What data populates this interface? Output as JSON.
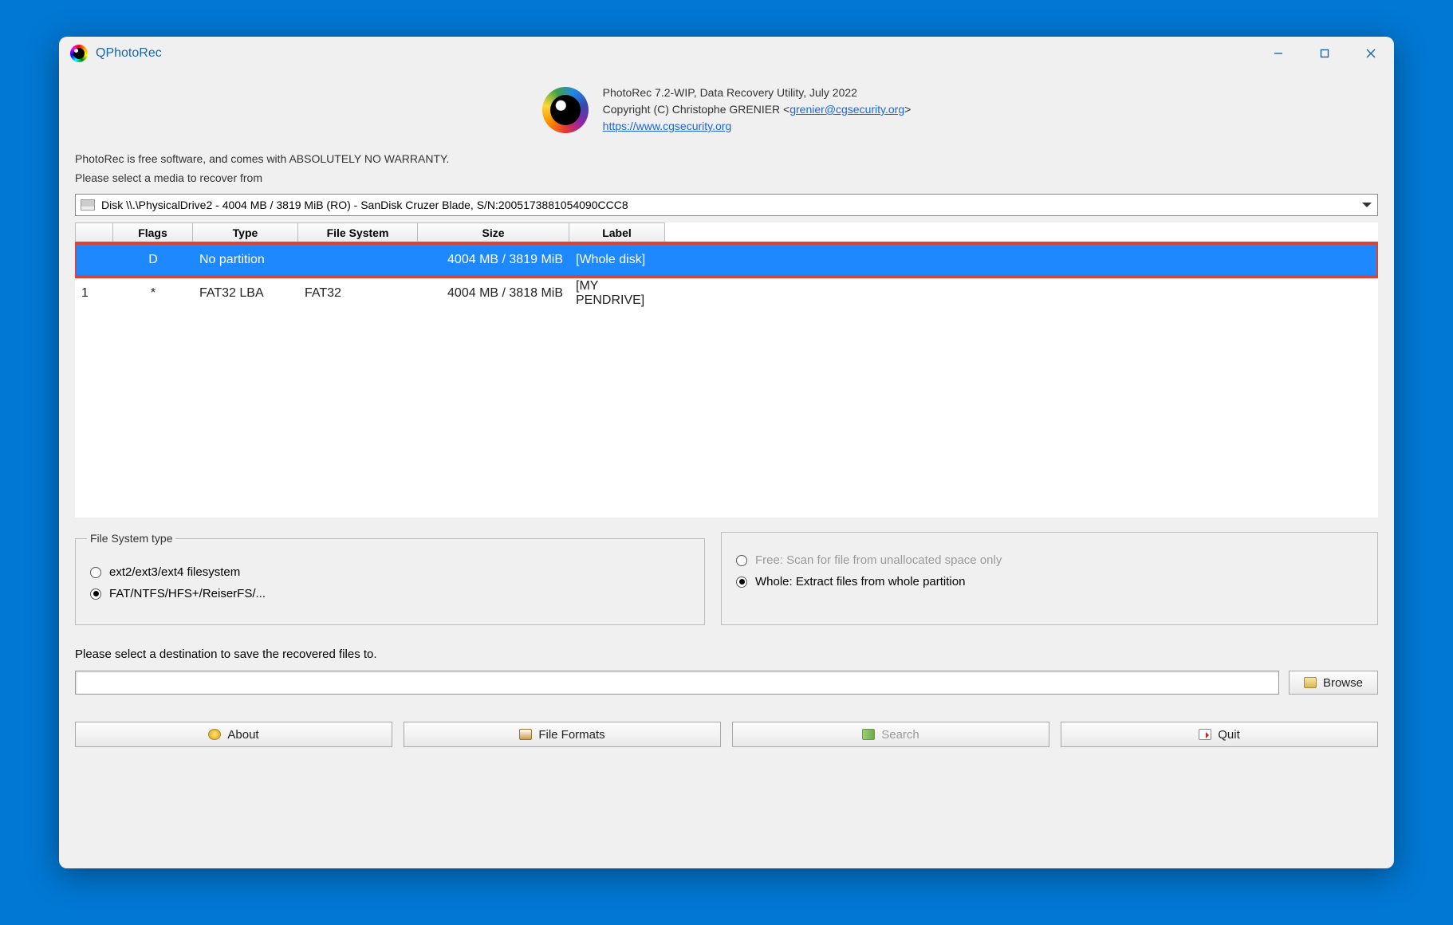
{
  "window": {
    "title": "QPhotoRec"
  },
  "header": {
    "line1": "PhotoRec 7.2-WIP, Data Recovery Utility, July 2022",
    "line2_prefix": "Copyright (C) Christophe GRENIER <",
    "line2_email": "grenier@cgsecurity.org",
    "line2_suffix": ">",
    "link": "https://www.cgsecurity.org"
  },
  "warranty": "PhotoRec is free software, and comes with ABSOLUTELY NO WARRANTY.",
  "select_media": "Please select a media to recover from",
  "dropdown_value": "Disk \\\\.\\PhysicalDrive2 - 4004 MB / 3819 MiB (RO) - SanDisk Cruzer Blade, S/N:2005173881054090CCC8",
  "table": {
    "headers": {
      "flags": "Flags",
      "type": "Type",
      "fs": "File System",
      "size": "Size",
      "label": "Label"
    },
    "rows": [
      {
        "idx": "",
        "flags": "D",
        "type": "No partition",
        "fs": "",
        "size": "4004 MB / 3819 MiB",
        "label": "[Whole disk]",
        "selected": true,
        "highlight": true
      },
      {
        "idx": "1",
        "flags": "*",
        "type": "FAT32 LBA",
        "fs": "FAT32",
        "size": "4004 MB / 3818 MiB",
        "label": "[MY PENDRIVE]",
        "selected": false,
        "highlight": false
      }
    ]
  },
  "fs_group": {
    "legend": "File System type",
    "opt_ext": "ext2/ext3/ext4 filesystem",
    "opt_fat": "FAT/NTFS/HFS+/ReiserFS/..."
  },
  "scan_group": {
    "opt_free": "Free: Scan for file from unallocated space only",
    "opt_whole": "Whole: Extract files from whole partition"
  },
  "dest_label": "Please select a destination to save the recovered files to.",
  "buttons": {
    "browse": "Browse",
    "about": "About",
    "formats": "File Formats",
    "search": "Search",
    "quit": "Quit"
  }
}
